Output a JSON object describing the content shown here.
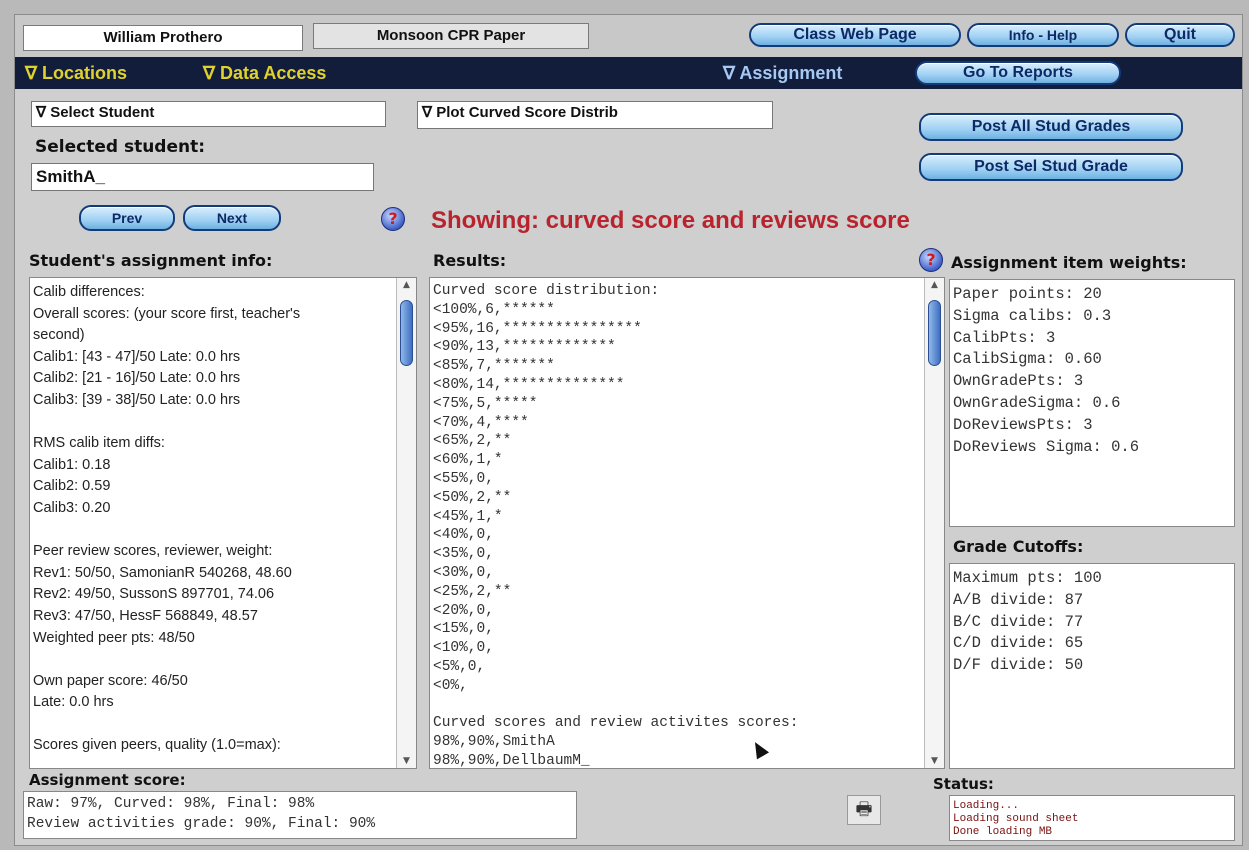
{
  "header": {
    "student_name": "William Prothero",
    "paper_name": "Monsoon CPR Paper",
    "class_web_page": "Class Web Page",
    "info_help": "Info - Help",
    "quit": "Quit"
  },
  "menubar": {
    "locations": "∇ Locations",
    "data_access": "∇ Data Access",
    "assignment": "∇ Assignment",
    "go_to_reports": "Go To Reports"
  },
  "controls": {
    "select_student": "∇ Select Student",
    "plot_select": "∇ Plot Curved Score Distrib",
    "post_all": "Post All Stud Grades",
    "post_sel": "Post Sel Stud Grade",
    "selected_student_label": "Selected student:",
    "selected_student_value": "SmithA_",
    "prev": "Prev",
    "next": "Next",
    "help_glyph": "?"
  },
  "showing": "Showing: curved score and reviews score",
  "panels": {
    "student_info_title": "Student's assignment info:",
    "student_info_text": "Calib differences:\nOverall scores: (your score first, teacher's\nsecond)\nCalib1: [43 - 47]/50 Late: 0.0 hrs\nCalib2: [21 - 16]/50 Late: 0.0 hrs\nCalib3: [39 - 38]/50 Late: 0.0 hrs\n\nRMS calib item diffs:\nCalib1: 0.18\nCalib2: 0.59\nCalib3: 0.20\n\nPeer review scores, reviewer, weight:\nRev1: 50/50, SamonianR 540268, 48.60\nRev2: 49/50, SussonS 897701, 74.06\nRev3: 47/50, HessF 568849, 48.57\nWeighted peer pts: 48/50\n\nOwn paper score: 46/50\nLate: 0.0 hrs\n\nScores given peers, quality (1.0=max):",
    "results_title": "Results:",
    "results_text": "Curved score distribution:\n<100%,6,******\n<95%,16,****************\n<90%,13,*************\n<85%,7,*******\n<80%,14,**************\n<75%,5,*****\n<70%,4,****\n<65%,2,**\n<60%,1,*\n<55%,0,\n<50%,2,**\n<45%,1,*\n<40%,0,\n<35%,0,\n<30%,0,\n<25%,2,**\n<20%,0,\n<15%,0,\n<10%,0,\n<5%,0,\n<0%,\n\nCurved scores and review activites scores:\n98%,90%,SmithA\n98%,90%,DellbaumM_",
    "weights_title": "Assignment item weights:",
    "weights_text": "Paper points: 20\nSigma calibs: 0.3\nCalibPts: 3\nCalibSigma: 0.60\nOwnGradePts: 3\nOwnGradeSigma: 0.6\nDoReviewsPts: 3\nDoReviews Sigma: 0.6",
    "cutoffs_title": "Grade Cutoffs:",
    "cutoffs_text": "Maximum pts: 100\nA/B divide: 87\nB/C divide: 77\nC/D divide: 65\nD/F divide: 50",
    "score_title": "Assignment score:",
    "score_text": "Raw: 97%, Curved: 98%, Final: 98%\nReview activities grade: 90%, Final: 90%",
    "status_title": "Status:",
    "status_text": "Loading...\nLoading sound sheet\nDone loading MB"
  },
  "icons": {
    "print": "printer-icon",
    "help": "help-icon"
  }
}
